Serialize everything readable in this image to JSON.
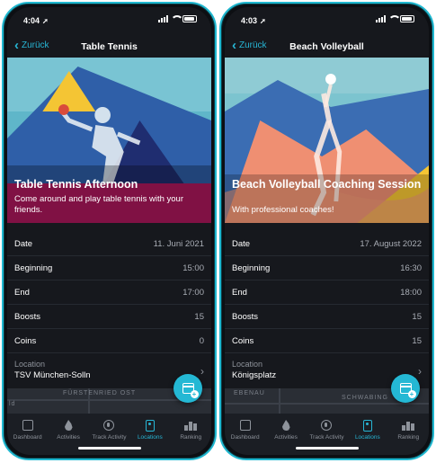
{
  "colors": {
    "accent": "#27b6d5",
    "screen_bg": "#16181d",
    "tab_bg": "#1b1e24"
  },
  "screens": [
    {
      "status": {
        "time": "4:04"
      },
      "nav": {
        "back_label": "Zurück",
        "title": "Table Tennis"
      },
      "hero": {
        "title": "Table Tennis Afternoon",
        "subtitle": "Come around and play table tennis with your friends."
      },
      "details": [
        {
          "label": "Date",
          "value": "11. Juni 2021"
        },
        {
          "label": "Beginning",
          "value": "15:00"
        },
        {
          "label": "End",
          "value": "17:00"
        },
        {
          "label": "Boosts",
          "value": "15"
        },
        {
          "label": "Coins",
          "value": "0"
        }
      ],
      "location": {
        "label": "Location",
        "value": "TSV München-Solln"
      },
      "map": {
        "street": "FÜRSTENRIED OST",
        "edge_text": "ld"
      }
    },
    {
      "status": {
        "time": "4:03"
      },
      "nav": {
        "back_label": "Zurück",
        "title": "Beach Volleyball"
      },
      "hero": {
        "title": "Beach Volleyball Coaching Session",
        "subtitle": "With professional coaches!"
      },
      "details": [
        {
          "label": "Date",
          "value": "17. August 2022"
        },
        {
          "label": "Beginning",
          "value": "16:30"
        },
        {
          "label": "End",
          "value": "18:00"
        },
        {
          "label": "Boosts",
          "value": "15"
        },
        {
          "label": "Coins",
          "value": "15"
        }
      ],
      "location": {
        "label": "Location",
        "value": "Königsplatz"
      },
      "map": {
        "street": "SCHWABING",
        "edge_text": "EBENAU"
      }
    }
  ],
  "tabs": [
    {
      "label": "Dashboard",
      "icon": "dashboard-icon"
    },
    {
      "label": "Activities",
      "icon": "flame-icon"
    },
    {
      "label": "Track Activity",
      "icon": "track-activity-icon"
    },
    {
      "label": "Locations",
      "icon": "location-card-icon",
      "active": true
    },
    {
      "label": "Ranking",
      "icon": "ranking-icon"
    }
  ]
}
